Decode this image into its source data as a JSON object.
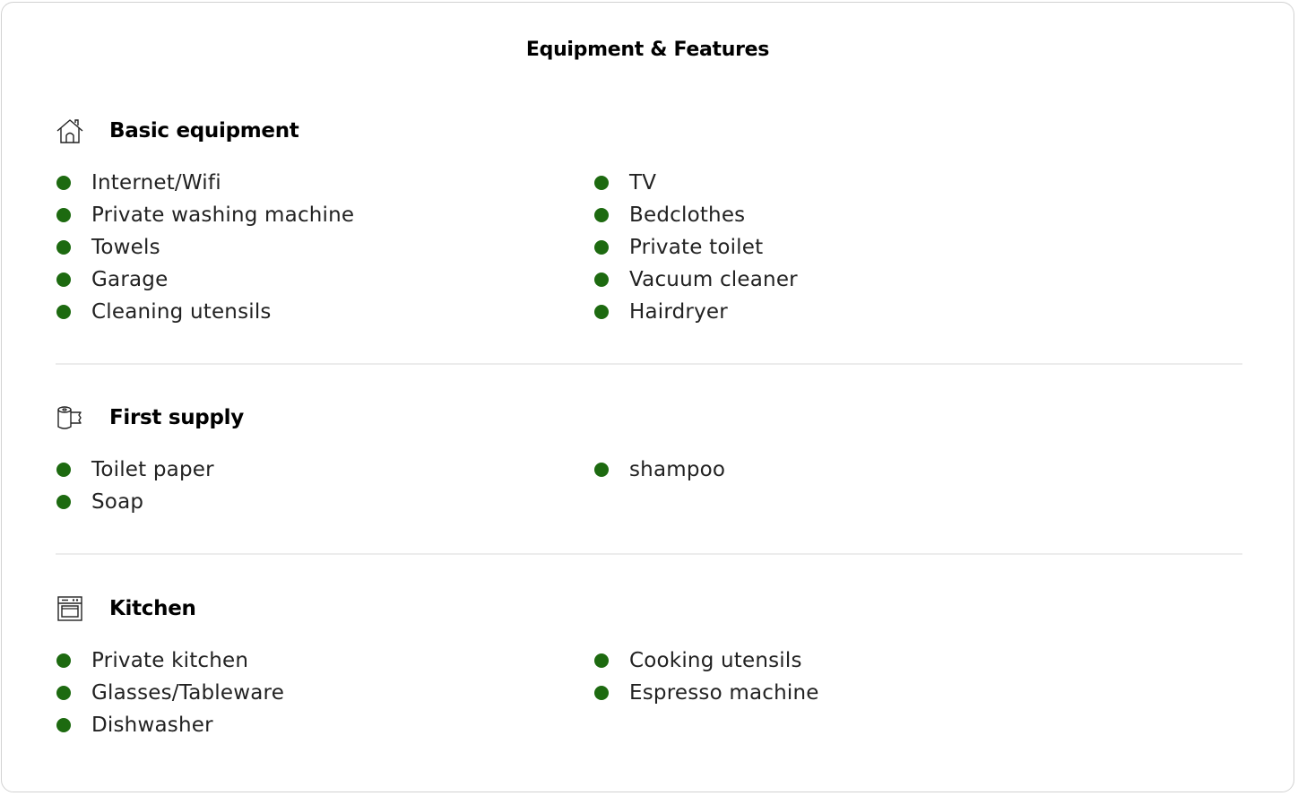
{
  "title": "Equipment & Features",
  "sections": [
    {
      "title": "Basic equipment",
      "icon": "house-icon",
      "col1": [
        "Internet/Wifi",
        "Private washing machine",
        "Towels",
        "Garage",
        "Cleaning utensils"
      ],
      "col2": [
        "TV",
        "Bedclothes",
        "Private toilet",
        "Vacuum cleaner",
        "Hairdryer"
      ]
    },
    {
      "title": "First supply",
      "icon": "toilet-paper-icon",
      "col1": [
        "Toilet paper",
        "Soap"
      ],
      "col2": [
        "shampoo"
      ]
    },
    {
      "title": "Kitchen",
      "icon": "oven-icon",
      "col1": [
        "Private kitchen",
        "Glasses/Tableware",
        "Dishwasher"
      ],
      "col2": [
        "Cooking utensils",
        "Espresso machine"
      ]
    }
  ],
  "colors": {
    "bullet": "#1d6a10",
    "border": "#d2d2d2",
    "divider": "#ececec"
  }
}
